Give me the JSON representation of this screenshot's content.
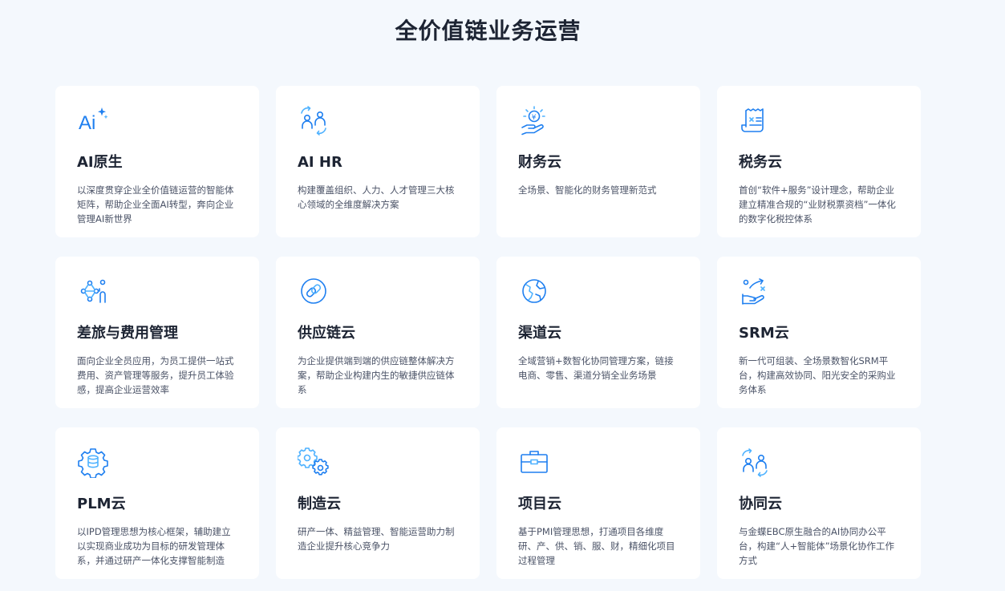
{
  "page": {
    "title": "全价值链业务运营"
  },
  "colors": {
    "background": "#f4f8fd",
    "card": "#ffffff",
    "accent": "#1e7ff0",
    "title": "#1d2433",
    "text": "#4a5266"
  },
  "cards": [
    {
      "icon": "ai-sparkle-icon",
      "title": "AI原生",
      "desc": "以深度贯穿企业全价值链运营的智能体矩阵，帮助企业全面AI转型，奔向企业管理AI新世界"
    },
    {
      "icon": "people-exchange-icon",
      "title": "AI HR",
      "desc": "构建覆盖组织、人力、人才管理三大核心领域的全维度解决方案"
    },
    {
      "icon": "coin-hand-icon",
      "title": "财务云",
      "desc": "全场景、智能化的财务管理新范式"
    },
    {
      "icon": "tax-receipt-icon",
      "title": "税务云",
      "desc": "首创“软件+服务”设计理念，帮助企业建立精准合规的“业财税票资档”一体化的数字化税控体系"
    },
    {
      "icon": "travel-network-icon",
      "title": "差旅与费用管理",
      "desc": "面向企业全员应用，为员工提供一站式费用、资产管理等服务，提升员工体验感，提高企业运营效率"
    },
    {
      "icon": "chain-link-icon",
      "title": "供应链云",
      "desc": "为企业提供端到端的供应链整体解决方案，帮助企业构建内生的敏捷供应链体系"
    },
    {
      "icon": "globe-icon",
      "title": "渠道云",
      "desc": "全域营销+数智化协同管理方案，链接电商、零售、渠道分销全业务场景"
    },
    {
      "icon": "strategy-hand-icon",
      "title": "SRM云",
      "desc": "新一代可组装、全场景数智化SRM平台，构建高效协同、阳光安全的采购业务体系"
    },
    {
      "icon": "database-gear-icon",
      "title": "PLM云",
      "desc": "以IPD管理思想为核心框架，辅助建立以实现商业成功为目标的研发管理体系，并通过研产一体化支撑智能制造"
    },
    {
      "icon": "gears-icon",
      "title": "制造云",
      "desc": "研产一体、精益管理、智能运营助力制造企业提升核心竞争力"
    },
    {
      "icon": "briefcase-icon",
      "title": "项目云",
      "desc": "基于PMI管理思想，打通项目各维度研、产、供、销、服、财，精细化项目过程管理"
    },
    {
      "icon": "collaboration-icon",
      "title": "协同云",
      "desc": "与金蝶EBC原生融合的AI协同办公平台，构建“人+智能体”场景化协作工作方式"
    }
  ]
}
